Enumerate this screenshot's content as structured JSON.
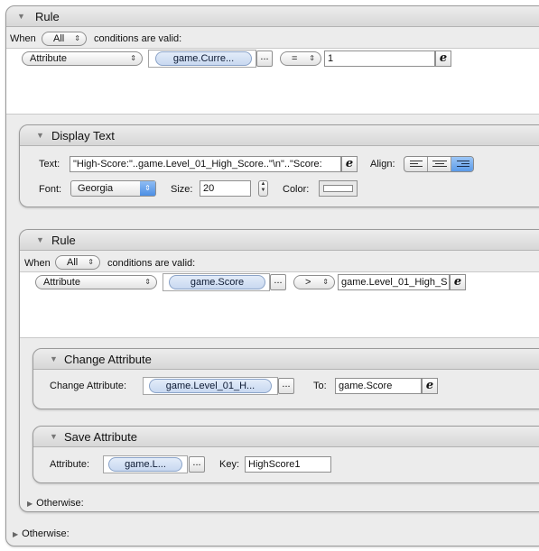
{
  "rule1": {
    "title": "Rule",
    "when_label": "When",
    "when_value": "All",
    "conditions_label": "conditions are valid:",
    "condition": {
      "type": "Attribute",
      "attribute": "game.Curre...",
      "dots": "...",
      "operator": "=",
      "value": "1"
    },
    "otherwise": "Otherwise:"
  },
  "display_text": {
    "title": "Display Text",
    "text_label": "Text:",
    "text_value": "\"High-Score:\"..game.Level_01_High_Score..\"\\n\"..\"Score:",
    "align_label": "Align:",
    "font_label": "Font:",
    "font_value": "Georgia",
    "size_label": "Size:",
    "size_value": "20",
    "color_label": "Color:",
    "color_value": "#ffffff"
  },
  "rule2": {
    "title": "Rule",
    "when_label": "When",
    "when_value": "All",
    "conditions_label": "conditions are valid:",
    "condition": {
      "type": "Attribute",
      "attribute": "game.Score",
      "dots": "...",
      "operator": ">",
      "value": "game.Level_01_High_S"
    },
    "otherwise": "Otherwise:"
  },
  "change_attribute": {
    "title": "Change Attribute",
    "label": "Change Attribute:",
    "attribute": "game.Level_01_H...",
    "dots": "...",
    "to_label": "To:",
    "to_value": "game.Score"
  },
  "save_attribute": {
    "title": "Save Attribute",
    "attribute_label": "Attribute:",
    "attribute": "game.L...",
    "dots": "...",
    "key_label": "Key:",
    "key_value": "HighScore1"
  },
  "icons": {
    "expression": "e",
    "collapse": "triangle-down-icon",
    "expand": "triangle-right-icon"
  },
  "colors": {
    "token_blue": "#c8d8f0",
    "popup_selected": "#5b9ae8"
  }
}
